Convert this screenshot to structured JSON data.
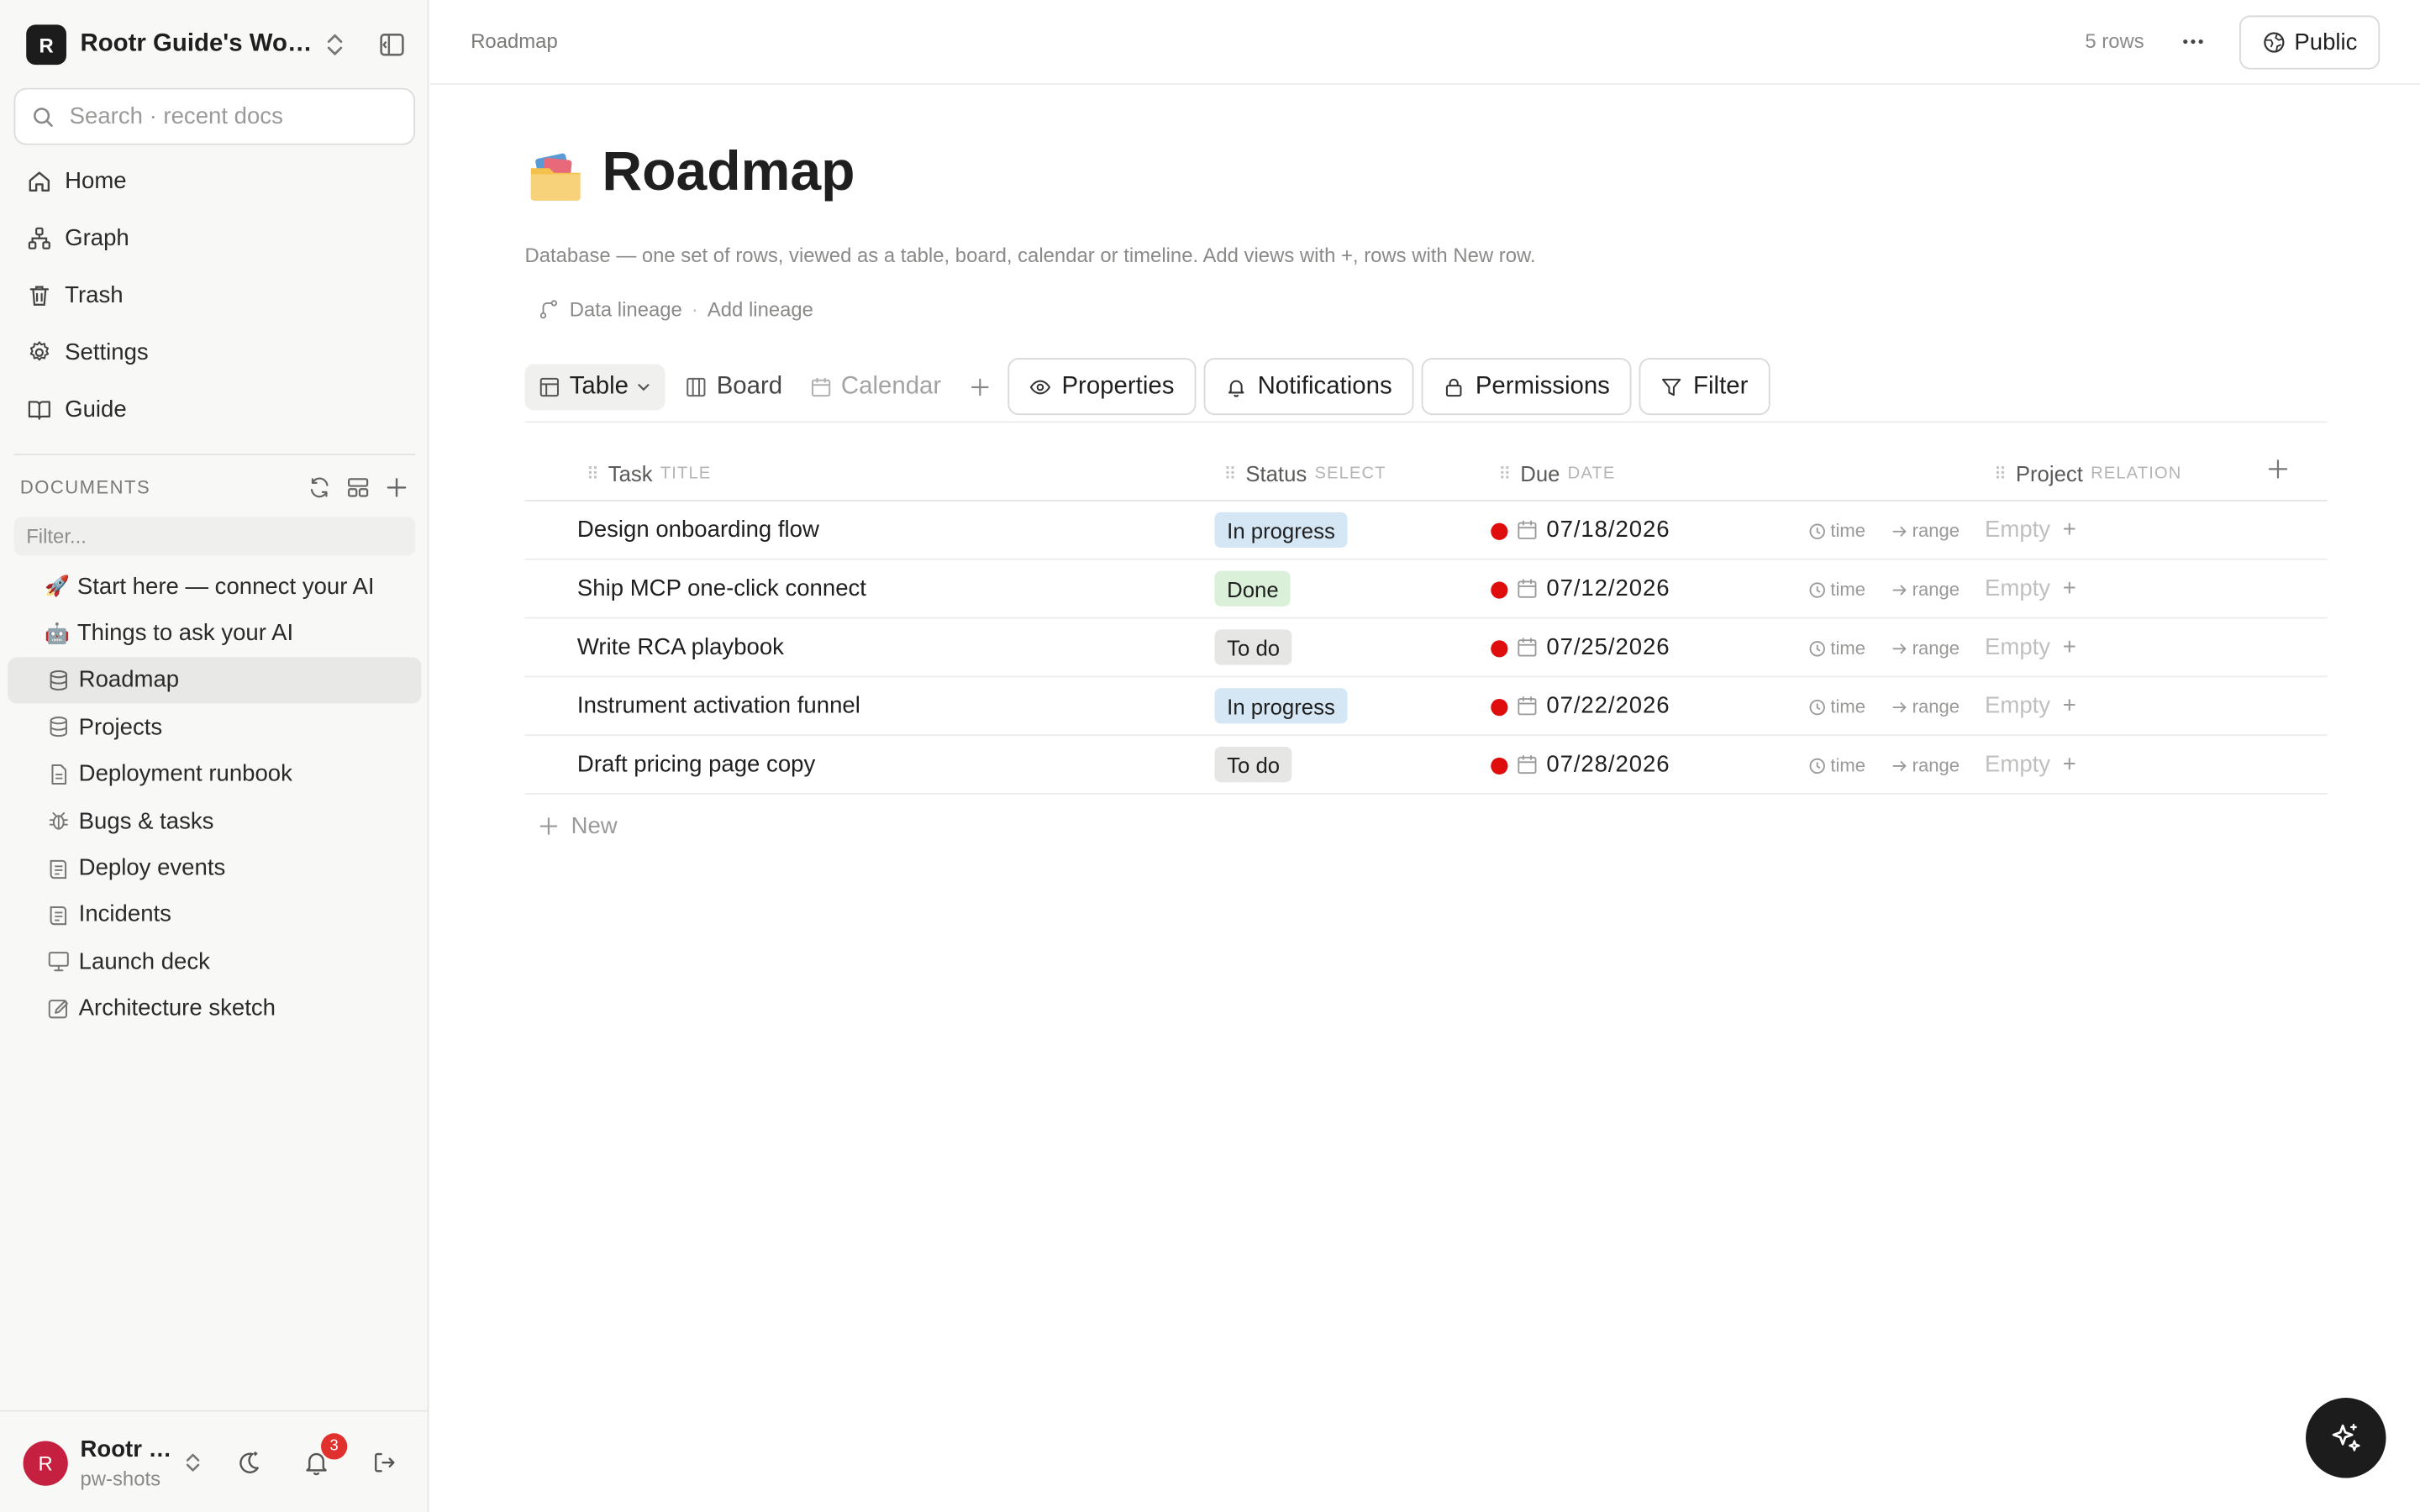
{
  "workspace": {
    "badge": "R",
    "name": "Rootr Guide's Workspace"
  },
  "search": {
    "placeholder": "Search · recent docs"
  },
  "nav": [
    {
      "label": "Home",
      "icon": "home-icon"
    },
    {
      "label": "Graph",
      "icon": "graph-icon"
    },
    {
      "label": "Trash",
      "icon": "trash-icon"
    },
    {
      "label": "Settings",
      "icon": "gear-icon"
    },
    {
      "label": "Guide",
      "icon": "book-icon"
    }
  ],
  "documents": {
    "title": "DOCUMENTS",
    "filter_placeholder": "Filter...",
    "items": [
      {
        "label": "Start here — connect your AI",
        "icon": "rocket-icon",
        "glyph": "🚀"
      },
      {
        "label": "Things to ask your AI",
        "icon": "robot-icon",
        "glyph": "🤖"
      },
      {
        "label": "Roadmap",
        "icon": "database-icon",
        "active": true
      },
      {
        "label": "Projects",
        "icon": "database-icon"
      },
      {
        "label": "Deployment runbook",
        "icon": "document-icon"
      },
      {
        "label": "Bugs & tasks",
        "icon": "bug-icon"
      },
      {
        "label": "Deploy events",
        "icon": "log-icon"
      },
      {
        "label": "Incidents",
        "icon": "log-icon"
      },
      {
        "label": "Launch deck",
        "icon": "presentation-icon"
      },
      {
        "label": "Architecture sketch",
        "icon": "sketch-icon"
      }
    ]
  },
  "user": {
    "avatar": "R",
    "name": "Rootr Guide",
    "sub": "pw-shots",
    "notifications": "3"
  },
  "topbar": {
    "breadcrumb": "Roadmap",
    "rows_count": "5 rows",
    "public_label": "Public"
  },
  "page": {
    "title": "Roadmap",
    "description": "Database — one set of rows, viewed as a table, board, calendar or timeline. Add views with +, rows with New row.",
    "lineage": "Data lineage",
    "add_lineage": "Add lineage"
  },
  "views": [
    {
      "label": "Table",
      "active": true
    },
    {
      "label": "Board"
    },
    {
      "label": "Calendar"
    }
  ],
  "toolbar": {
    "properties": "Properties",
    "notifications": "Notifications",
    "permissions": "Permissions",
    "filter": "Filter"
  },
  "columns": [
    {
      "name": "Task",
      "type": "TITLE"
    },
    {
      "name": "Status",
      "type": "SELECT"
    },
    {
      "name": "Due",
      "type": "DATE"
    },
    {
      "name": "Project",
      "type": "RELATION"
    }
  ],
  "rows": [
    {
      "task": "Design onboarding flow",
      "status": "In progress",
      "due": "07/18/2026",
      "project": "Empty"
    },
    {
      "task": "Ship MCP one-click connect",
      "status": "Done",
      "due": "07/12/2026",
      "project": "Empty"
    },
    {
      "task": "Write RCA playbook",
      "status": "To do",
      "due": "07/25/2026",
      "project": "Empty"
    },
    {
      "task": "Instrument activation funnel",
      "status": "In progress",
      "due": "07/22/2026",
      "project": "Empty"
    },
    {
      "task": "Draft pricing page copy",
      "status": "To do",
      "due": "07/28/2026",
      "project": "Empty"
    }
  ],
  "row_labels": {
    "time": "time",
    "range": "range"
  },
  "new_row_label": "New",
  "colors": {
    "due_dot": "#e00d0d",
    "in_progress": "#d5e7f5",
    "done": "#daf0d9",
    "todo": "#e6e6e4",
    "avatar": "#c5203f"
  }
}
